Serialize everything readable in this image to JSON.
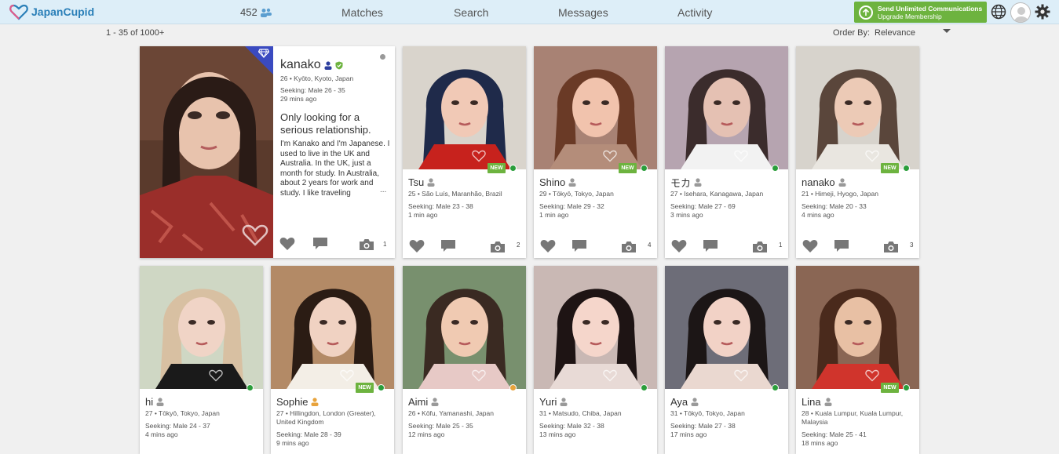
{
  "header": {
    "logo": "JapanCupid",
    "count": "452",
    "nav": [
      "Matches",
      "Search",
      "Messages",
      "Activity"
    ],
    "upgrade_line1": "Send Unlimited Communications",
    "upgrade_line2": "Upgrade Membership"
  },
  "toolbar": {
    "results": "1 - 35 of 1000+",
    "order_label": "Order By:",
    "order_value": "Relevance"
  },
  "featured": {
    "name": "kanako",
    "location": "26 • Kyōto, Kyoto, Japan",
    "seeking": "Seeking: Male 26 - 35",
    "time": "29 mins ago",
    "headline": "Only looking for a serious relationship.",
    "about": "I'm Kanako and I'm Japanese. I used to live in the UK and Australia. In the UK, just a month for study. In Australia, about 2 years for work and study. I like traveling",
    "ellipsis": "...",
    "photo_count": "1"
  },
  "profiles": [
    {
      "name": "Tsu",
      "location": "25 • São Luís, Maranhão, Brazil",
      "seeking": "Seeking: Male 23 - 38",
      "time": "1 min ago",
      "photos": "2",
      "new": "NEW"
    },
    {
      "name": "Shino",
      "location": "29 • Tōkyō, Tokyo, Japan",
      "seeking": "Seeking: Male 29 - 32",
      "time": "1 min ago",
      "photos": "4",
      "new": "NEW"
    },
    {
      "name": "モカ",
      "location": "27 • Isehara, Kanagawa, Japan",
      "seeking": "Seeking: Male 27 - 69",
      "time": "3 mins ago",
      "photos": "1",
      "new": ""
    },
    {
      "name": "nanako",
      "location": "21 • Himeji, Hyogo, Japan",
      "seeking": "Seeking: Male 20 - 33",
      "time": "4 mins ago",
      "photos": "3",
      "new": "NEW"
    },
    {
      "name": "hi",
      "location": "27 • Tōkyō, Tokyo, Japan",
      "seeking": "Seeking: Male 24 - 37",
      "time": "4 mins ago",
      "photos": "",
      "new": ""
    },
    {
      "name": "Sophie",
      "location": "27 • Hillingdon, London (Greater), United Kingdom",
      "seeking": "Seeking: Male 28 - 39",
      "time": "9 mins ago",
      "photos": "",
      "new": "NEW"
    },
    {
      "name": "Aimi",
      "location": "26 • Kōfu, Yamanashi, Japan",
      "seeking": "Seeking: Male 25 - 35",
      "time": "12 mins ago",
      "photos": "",
      "new": ""
    },
    {
      "name": "Yuri",
      "location": "31 • Matsudo, Chiba, Japan",
      "seeking": "Seeking: Male 32 - 38",
      "time": "13 mins ago",
      "photos": "",
      "new": ""
    },
    {
      "name": "Aya",
      "location": "31 • Tōkyō, Tokyo, Japan",
      "seeking": "Seeking: Male 27 - 38",
      "time": "17 mins ago",
      "photos": "",
      "new": ""
    },
    {
      "name": "Lina",
      "location": "28 • Kuala Lumpur, Kuala Lumpur, Malaysia",
      "seeking": "Seeking: Male 25 - 41",
      "time": "18 mins ago",
      "photos": "",
      "new": "NEW"
    }
  ],
  "colors": {
    "brand": "#2a7fb8",
    "upgrade": "#6db33f",
    "online": "#2a9d3a",
    "topbar": "#ddeef8"
  }
}
